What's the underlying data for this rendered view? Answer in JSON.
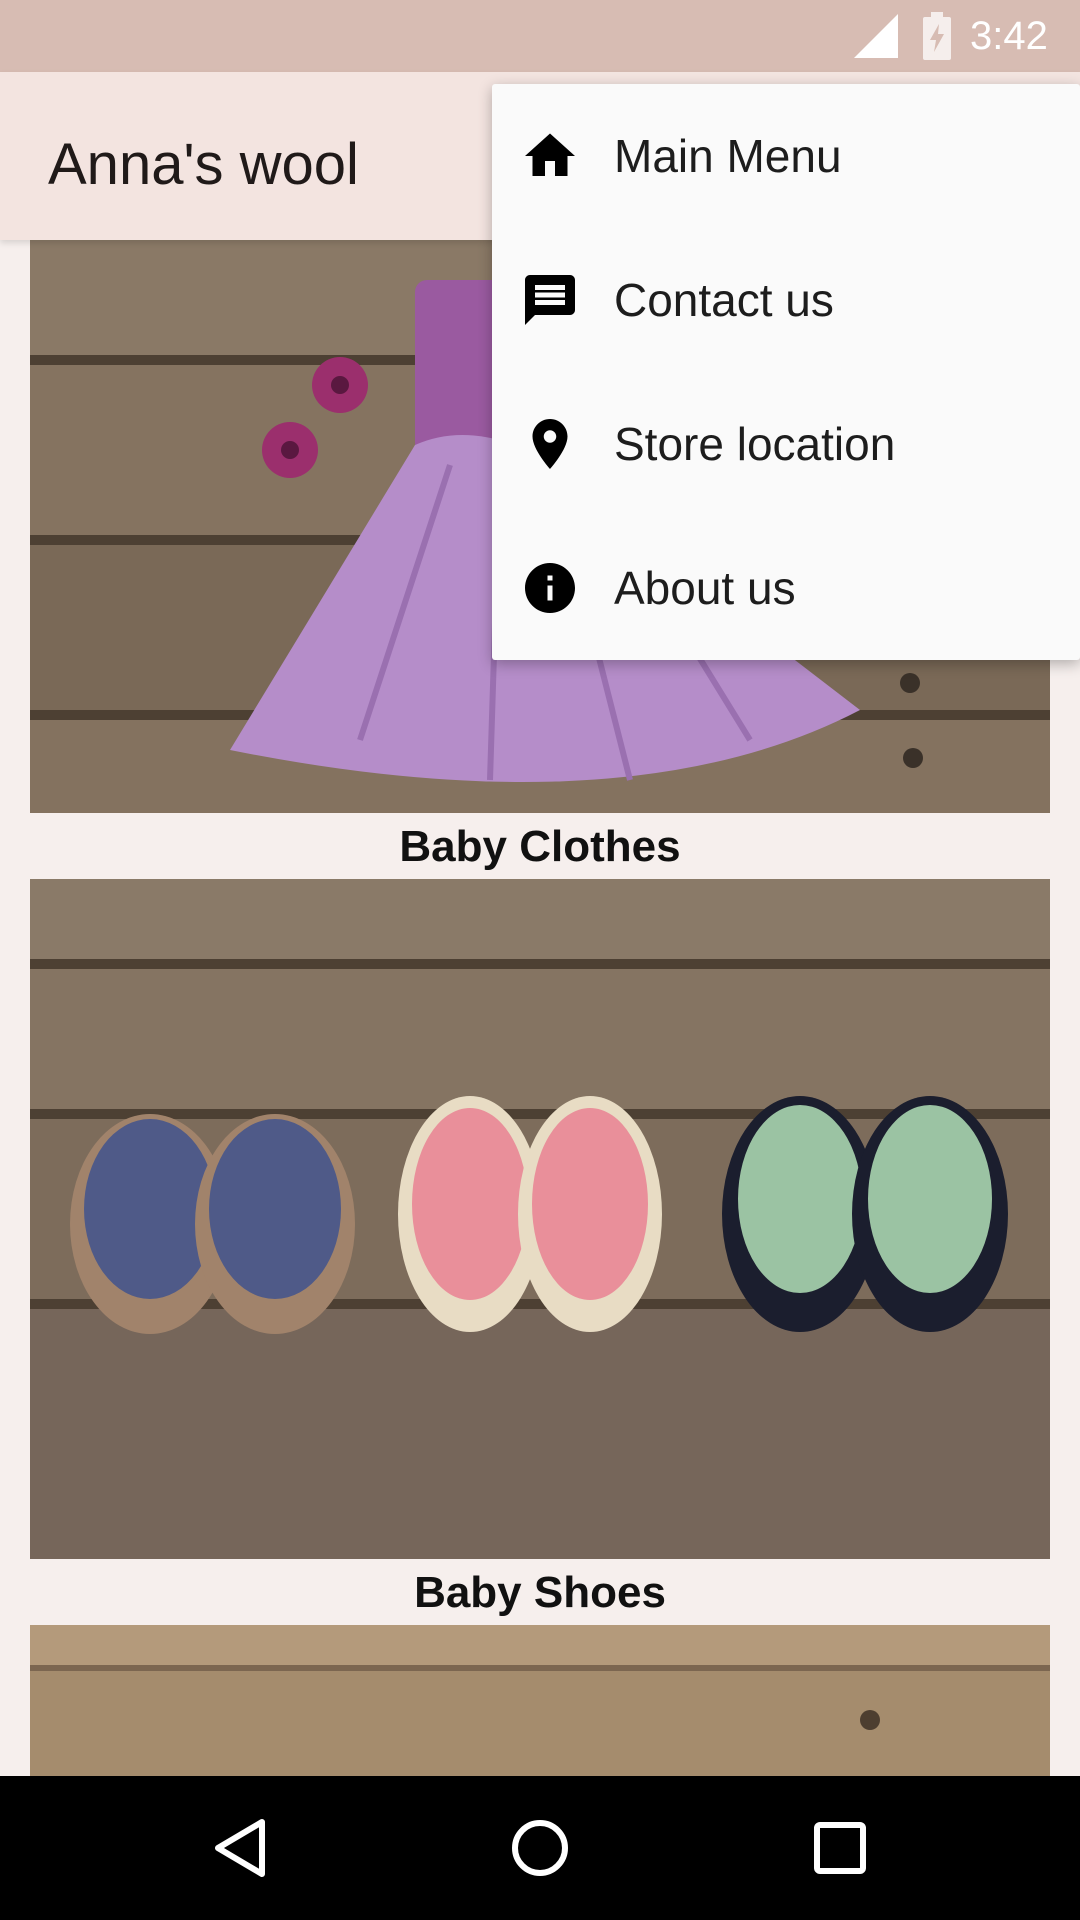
{
  "status_bar": {
    "time": "3:42",
    "icons": [
      "cell-signal-icon",
      "battery-charging-icon"
    ]
  },
  "app_bar": {
    "title": "Anna's wool"
  },
  "content": {
    "cards": [
      {
        "caption": "Baby Clothes",
        "image": "crocheted lilac baby dress on wooden boards"
      },
      {
        "caption": "Baby Shoes",
        "image": "three pairs of crocheted baby sneakers on wooden boards"
      },
      {
        "caption": "",
        "image": "wooden boards"
      }
    ]
  },
  "menu": {
    "items": [
      {
        "label": "Main Menu",
        "icon": "home-icon"
      },
      {
        "label": "Contact us",
        "icon": "message-icon"
      },
      {
        "label": "Store location",
        "icon": "location-pin-icon"
      },
      {
        "label": "About us",
        "icon": "info-icon"
      }
    ]
  },
  "nav_bar": {
    "buttons": [
      "back-icon",
      "home-circle-icon",
      "recents-icon"
    ]
  },
  "colors": {
    "status_bar": "#d7bcb3",
    "app_bar": "#f3e4e0",
    "background": "#f6efed",
    "menu": "#fafafa",
    "nav_bar": "#000000"
  }
}
